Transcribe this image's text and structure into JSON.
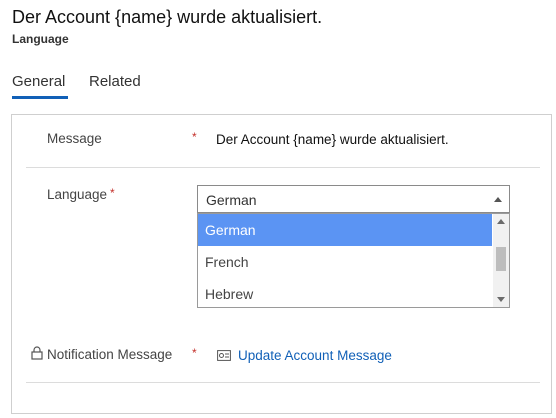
{
  "header": {
    "title": "Der Account {name} wurde aktualisiert.",
    "subtitle": "Language"
  },
  "tabs": [
    {
      "label": "General",
      "active": true
    },
    {
      "label": "Related",
      "active": false
    }
  ],
  "form": {
    "message": {
      "label": "Message",
      "required_marker": "*",
      "value": "Der Account {name} wurde aktualisiert."
    },
    "language": {
      "label": "Language",
      "required_marker": "*",
      "selected": "German",
      "options": [
        {
          "label": "German",
          "highlighted": true
        },
        {
          "label": "French",
          "highlighted": false
        },
        {
          "label": "Hebrew",
          "highlighted": false
        }
      ]
    },
    "notification_message": {
      "label": "Notification Message",
      "required_marker": "*",
      "link_text": "Update Account Message",
      "locked": true
    }
  },
  "icons": {
    "lock": "lock-icon",
    "link_entity": "entity-link-icon",
    "dropdown": "chevron-up-icon"
  },
  "colors": {
    "accent": "#1160b7",
    "required": "#c4312b",
    "option_highlight": "#5b94f3"
  }
}
